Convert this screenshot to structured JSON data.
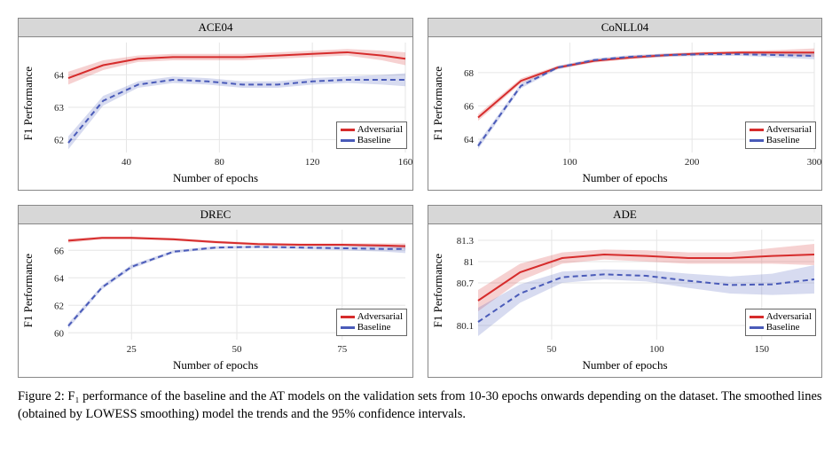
{
  "caption": "Figure 2: F₁ performance of the baseline and the AT models on the validation sets from 10-30 epochs onwards depending on the dataset. The smoothed lines (obtained by LOWESS smoothing) model the trends and the 95% confidence intervals.",
  "ylabel": "F1 Performance",
  "xlabel": "Number of epochs",
  "legend": {
    "adversarial": "Adversarial",
    "baseline": "Baseline"
  },
  "colors": {
    "adversarial": "#d62c2c",
    "baseline": "#4a5bb9"
  },
  "chart_data": [
    {
      "id": "ace04",
      "title": "ACE04",
      "x_ticks": [
        40,
        80,
        120,
        160
      ],
      "y_ticks": [
        62,
        63,
        64
      ],
      "xlim": [
        15,
        160
      ],
      "ylim": [
        61.6,
        65.0
      ],
      "series": [
        {
          "name": "Adversarial",
          "style": "solid",
          "x": [
            15,
            30,
            45,
            60,
            75,
            90,
            105,
            120,
            135,
            150,
            160
          ],
          "y": [
            63.9,
            64.3,
            64.5,
            64.55,
            64.55,
            64.55,
            64.6,
            64.65,
            64.7,
            64.6,
            64.5
          ],
          "lo": [
            63.7,
            64.15,
            64.4,
            64.45,
            64.45,
            64.45,
            64.5,
            64.55,
            64.6,
            64.45,
            64.3
          ],
          "hi": [
            64.1,
            64.45,
            64.6,
            64.65,
            64.65,
            64.65,
            64.7,
            64.75,
            64.8,
            64.75,
            64.7
          ]
        },
        {
          "name": "Baseline",
          "style": "dashed",
          "x": [
            15,
            30,
            45,
            60,
            75,
            90,
            105,
            120,
            135,
            150,
            160
          ],
          "y": [
            61.9,
            63.2,
            63.7,
            63.85,
            63.8,
            63.7,
            63.7,
            63.8,
            63.85,
            63.85,
            63.85
          ],
          "lo": [
            61.7,
            63.05,
            63.6,
            63.75,
            63.7,
            63.6,
            63.6,
            63.7,
            63.75,
            63.7,
            63.65
          ],
          "hi": [
            62.1,
            63.35,
            63.8,
            63.95,
            63.9,
            63.8,
            63.8,
            63.9,
            63.95,
            64.0,
            64.05
          ]
        }
      ]
    },
    {
      "id": "conll04",
      "title": "CoNLL04",
      "x_ticks": [
        100,
        200,
        300
      ],
      "y_ticks": [
        64,
        66,
        68
      ],
      "xlim": [
        25,
        300
      ],
      "ylim": [
        63.2,
        69.8
      ],
      "series": [
        {
          "name": "Adversarial",
          "style": "solid",
          "x": [
            25,
            60,
            90,
            120,
            150,
            180,
            210,
            240,
            270,
            300
          ],
          "y": [
            65.3,
            67.5,
            68.3,
            68.7,
            68.9,
            69.05,
            69.15,
            69.2,
            69.2,
            69.2
          ],
          "lo": [
            65.1,
            67.35,
            68.2,
            68.6,
            68.8,
            68.95,
            69.05,
            69.1,
            69.05,
            68.95
          ],
          "hi": [
            65.5,
            67.65,
            68.4,
            68.8,
            69.0,
            69.15,
            69.25,
            69.3,
            69.35,
            69.45
          ]
        },
        {
          "name": "Baseline",
          "style": "dashed",
          "x": [
            25,
            60,
            90,
            120,
            150,
            180,
            210,
            240,
            270,
            300
          ],
          "y": [
            63.6,
            67.2,
            68.3,
            68.75,
            68.95,
            69.05,
            69.1,
            69.1,
            69.05,
            69.0
          ],
          "lo": [
            63.4,
            67.05,
            68.2,
            68.65,
            68.85,
            68.95,
            69.0,
            69.0,
            68.9,
            68.8
          ],
          "hi": [
            63.8,
            67.35,
            68.4,
            68.85,
            69.05,
            69.15,
            69.2,
            69.2,
            69.2,
            69.2
          ]
        }
      ]
    },
    {
      "id": "drec",
      "title": "DREC",
      "x_ticks": [
        25,
        50,
        75
      ],
      "y_ticks": [
        60,
        62,
        64,
        66
      ],
      "xlim": [
        10,
        90
      ],
      "ylim": [
        59.5,
        67.5
      ],
      "series": [
        {
          "name": "Adversarial",
          "style": "solid",
          "x": [
            10,
            18,
            25,
            35,
            45,
            55,
            65,
            75,
            85,
            90
          ],
          "y": [
            66.7,
            66.9,
            66.9,
            66.8,
            66.6,
            66.45,
            66.4,
            66.4,
            66.35,
            66.3
          ],
          "lo": [
            66.55,
            66.8,
            66.8,
            66.7,
            66.5,
            66.35,
            66.3,
            66.3,
            66.2,
            66.1
          ],
          "hi": [
            66.85,
            67.0,
            67.0,
            66.9,
            66.7,
            66.55,
            66.5,
            66.5,
            66.5,
            66.5
          ]
        },
        {
          "name": "Baseline",
          "style": "dashed",
          "x": [
            10,
            18,
            25,
            35,
            45,
            55,
            65,
            75,
            85,
            90
          ],
          "y": [
            60.5,
            63.3,
            64.8,
            65.9,
            66.2,
            66.25,
            66.2,
            66.15,
            66.1,
            66.1
          ],
          "lo": [
            60.3,
            63.15,
            64.65,
            65.8,
            66.1,
            66.15,
            66.1,
            66.0,
            65.9,
            65.8
          ],
          "hi": [
            60.7,
            63.45,
            64.95,
            66.0,
            66.3,
            66.35,
            66.3,
            66.3,
            66.3,
            66.4
          ]
        }
      ]
    },
    {
      "id": "ade",
      "title": "ADE",
      "x_ticks": [
        50,
        100,
        150
      ],
      "y_ticks": [
        80.1,
        80.7,
        81.0,
        81.3
      ],
      "xlim": [
        15,
        175
      ],
      "ylim": [
        79.9,
        81.45
      ],
      "series": [
        {
          "name": "Adversarial",
          "style": "solid",
          "x": [
            15,
            35,
            55,
            75,
            95,
            115,
            135,
            155,
            175
          ],
          "y": [
            80.45,
            80.85,
            81.05,
            81.1,
            81.08,
            81.05,
            81.05,
            81.08,
            81.1
          ],
          "lo": [
            80.3,
            80.73,
            80.97,
            81.03,
            81.0,
            80.97,
            80.97,
            80.97,
            80.95
          ],
          "hi": [
            80.6,
            80.97,
            81.13,
            81.17,
            81.16,
            81.13,
            81.13,
            81.19,
            81.25
          ]
        },
        {
          "name": "Baseline",
          "style": "dashed",
          "x": [
            15,
            35,
            55,
            75,
            95,
            115,
            135,
            155,
            175
          ],
          "y": [
            80.15,
            80.55,
            80.78,
            80.82,
            80.8,
            80.73,
            80.67,
            80.68,
            80.75
          ],
          "lo": [
            79.95,
            80.42,
            80.7,
            80.75,
            80.72,
            80.63,
            80.55,
            80.53,
            80.55
          ],
          "hi": [
            80.35,
            80.68,
            80.86,
            80.89,
            80.88,
            80.83,
            80.79,
            80.83,
            80.95
          ]
        }
      ]
    }
  ]
}
